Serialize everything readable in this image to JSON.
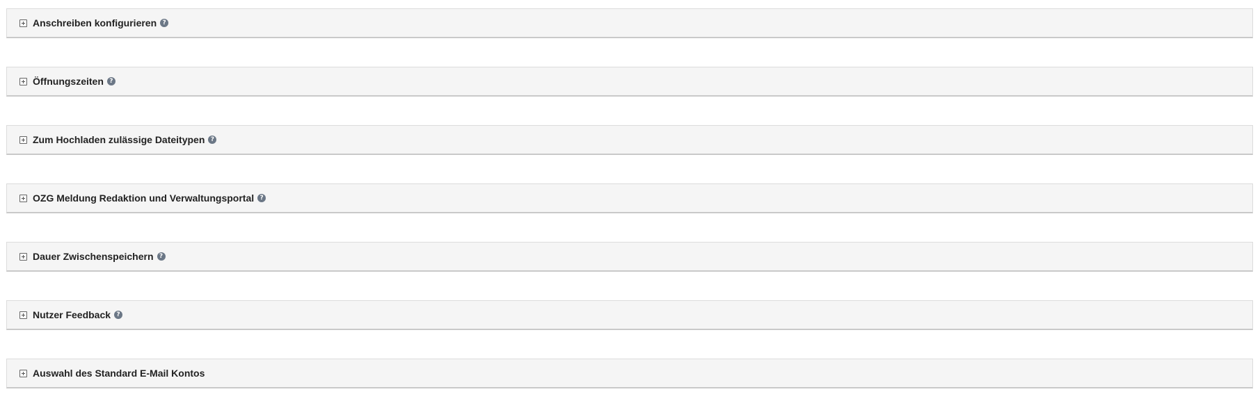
{
  "panels": [
    {
      "title": "Anschreiben konfigurieren",
      "help": true
    },
    {
      "title": "Öffnungszeiten",
      "help": true
    },
    {
      "title": "Zum Hochladen zulässige Dateitypen",
      "help": true
    },
    {
      "title": "OZG Meldung Redaktion und Verwaltungsportal",
      "help": true
    },
    {
      "title": "Dauer Zwischenspeichern",
      "help": true
    },
    {
      "title": "Nutzer Feedback",
      "help": true
    },
    {
      "title": "Auswahl des Standard E-Mail Kontos",
      "help": false
    }
  ],
  "icons": {
    "expand": "plus-square-icon",
    "help": "question-circle-icon",
    "help_glyph": "?"
  },
  "colors": {
    "panel_bg": "#f5f5f5",
    "border": "#dcdcdc",
    "help_icon": "#6b7786"
  }
}
